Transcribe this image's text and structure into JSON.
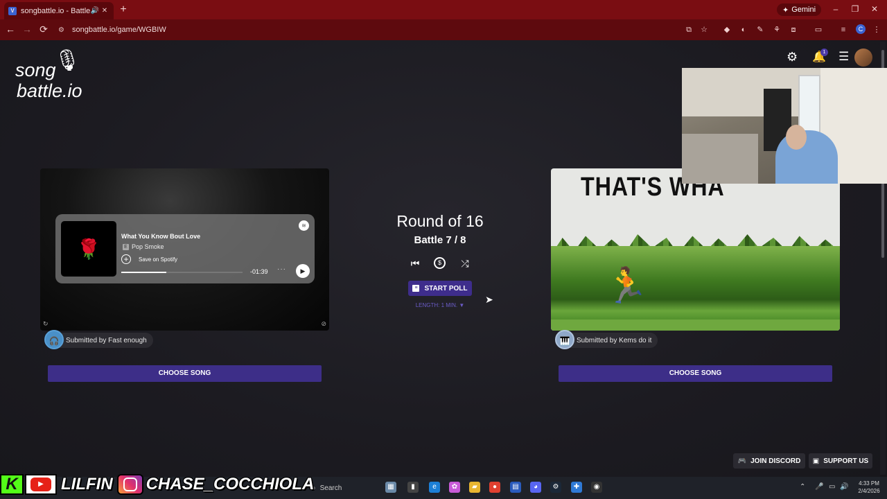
{
  "browser": {
    "tab_title": "songbattle.io - Battle Songs",
    "tab_favicon": "V",
    "new_tab": "+",
    "gemini_label": "Gemini",
    "url": "songbattle.io/game/WGBIW",
    "profile_initial": "C",
    "notification_count": "1",
    "minimize": "–",
    "restore": "❐",
    "close": "✕"
  },
  "app": {
    "logo_line1": "song",
    "logo_line2": "battle.io"
  },
  "center": {
    "round_label": "Round of 16",
    "battle_label": "Battle 7 / 8",
    "start_poll_label": "START POLL",
    "length_label": "LENGTH: 1 MIN. ▼"
  },
  "left": {
    "song_title": "What You Know Bout Love",
    "explicit_badge": "E",
    "artist": "Pop Smoke",
    "save_label": "Save on Spotify",
    "time_remaining": "-01:39",
    "progress": 0.37,
    "submitted_by": "Submitted by Fast enough",
    "choose_label": "CHOOSE SONG"
  },
  "right": {
    "video_caption": "THAT'S WHA",
    "submitted_by": "Submitted by Kems do it",
    "choose_label": "CHOOSE SONG"
  },
  "footer": {
    "discord_label": "JOIN DISCORD",
    "support_label": "SUPPORT US"
  },
  "overlay": {
    "k_label": "K",
    "youtube_name": "LILFIN",
    "instagram_name": "CHASE_COCCHIOLA"
  },
  "taskbar": {
    "search_label": "Search",
    "time": "4:33 PM",
    "date": "2/4/2026"
  },
  "colors": {
    "accent": "#3d2e88",
    "browser_frame": "#7a0d12",
    "page_bg": "#1b1a20"
  }
}
